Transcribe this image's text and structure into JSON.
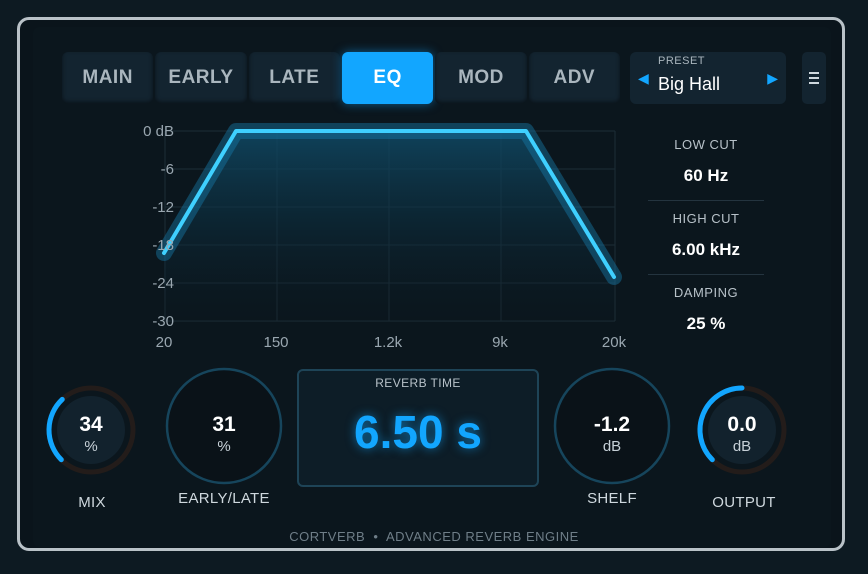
{
  "tabs": [
    "MAIN",
    "EARLY",
    "LATE",
    "EQ",
    "MOD",
    "ADV"
  ],
  "active_tab": "EQ",
  "preset": {
    "label": "PRESET",
    "name": "Big Hall",
    "prev_glyph": "◀",
    "next_glyph": "▶"
  },
  "menu_icon": "menu-icon",
  "eq": {
    "y_ticks": [
      "0 dB",
      "-6",
      "-12",
      "-18",
      "-24",
      "-30"
    ],
    "x_ticks": [
      "20",
      "150",
      "1.2k",
      "9k",
      "20k"
    ],
    "curve_color": "#3fd0ff"
  },
  "side_params": [
    {
      "title": "LOW CUT",
      "value": "60 Hz"
    },
    {
      "title": "HIGH CUT",
      "value": "6.00 kHz"
    },
    {
      "title": "DAMPING",
      "value": "25 %"
    }
  ],
  "knobs": {
    "mix": {
      "value": "34",
      "unit": "%",
      "label": "MIX",
      "level": 0.34
    },
    "early_late": {
      "value": "31",
      "unit": "%",
      "label": "EARLY/LATE"
    },
    "reverb_time": {
      "title": "REVERB TIME",
      "value": "6.50 s"
    },
    "shelf": {
      "value": "-1.2",
      "unit": "dB",
      "label": "SHELF"
    },
    "output": {
      "value": "0.0",
      "unit": "dB",
      "label": "OUTPUT",
      "level": 0.5
    }
  },
  "footer": {
    "brand": "CORTVERB",
    "bullet": "•",
    "tagline": "ADVANCED REVERB ENGINE"
  },
  "colors": {
    "accent": "#12a6ff",
    "panel": "#132430",
    "background": "#0b161d"
  }
}
